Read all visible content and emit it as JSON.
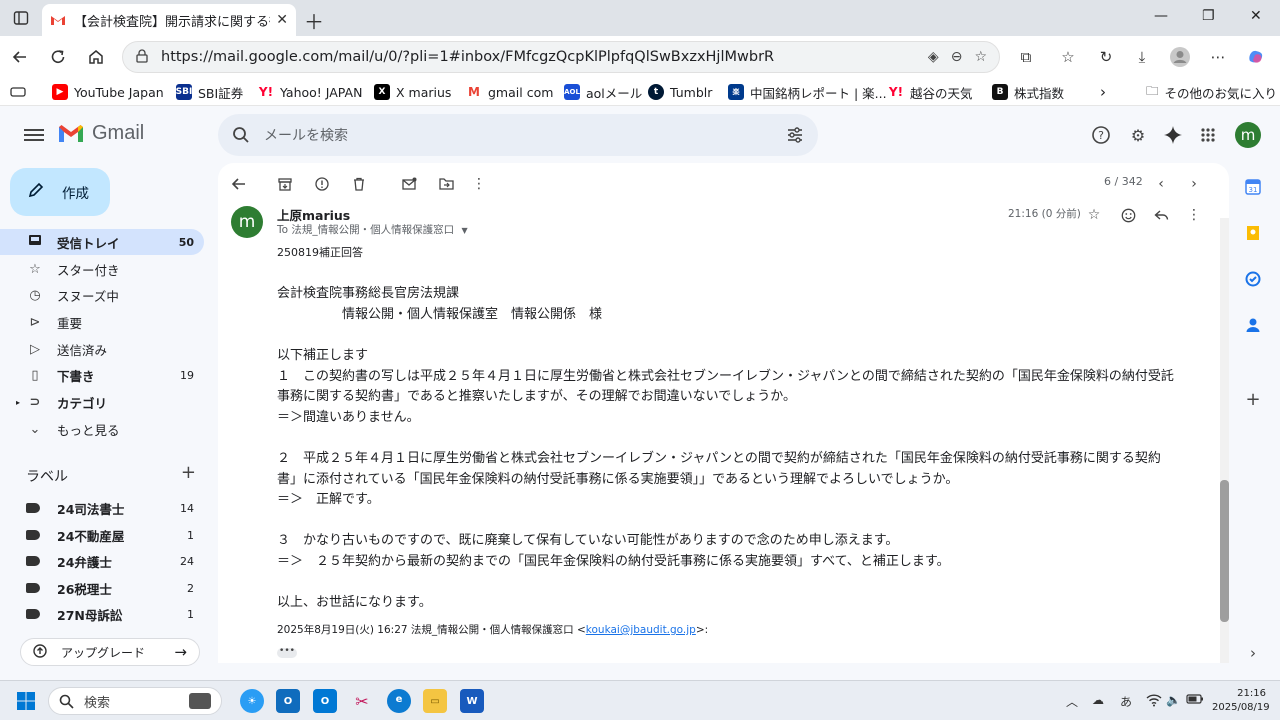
{
  "browser": {
    "tab_title": "【会計検査院】開示請求に関する御",
    "url": "https://mail.google.com/mail/u/0/?pli=1#inbox/FMfcgzQcpKlPlpfqQlSwBxzxHjlMwbrR",
    "bookmarks": [
      "YouTube Japan",
      "SBI証券",
      "Yahoo! JAPAN",
      "X marius",
      "gmail com",
      "aolメール",
      "Tumblr",
      "中国銘柄レポート | 楽...",
      "越谷の天気",
      "株式指数"
    ],
    "other_bookmarks": "その他のお気に入り"
  },
  "gmail": {
    "logo_text": "Gmail",
    "search_placeholder": "メールを検索",
    "avatar_initial": "m",
    "compose_label": "作成",
    "nav": [
      {
        "label": "受信トレイ",
        "count": "50"
      },
      {
        "label": "スター付き",
        "count": ""
      },
      {
        "label": "スヌーズ中",
        "count": ""
      },
      {
        "label": "重要",
        "count": ""
      },
      {
        "label": "送信済み",
        "count": ""
      },
      {
        "label": "下書き",
        "count": "19"
      },
      {
        "label": "カテゴリ",
        "count": ""
      },
      {
        "label": "もっと見る",
        "count": ""
      }
    ],
    "labels_title": "ラベル",
    "labels": [
      {
        "label": "24司法書士",
        "count": "14"
      },
      {
        "label": "24不動産屋",
        "count": "1"
      },
      {
        "label": "24弁護士",
        "count": "24"
      },
      {
        "label": "26税理士",
        "count": "2"
      },
      {
        "label": "27N母訴訟",
        "count": "1"
      }
    ],
    "upgrade_label": "アップグレード",
    "pager": "6 / 342"
  },
  "message": {
    "sender": "上原marius",
    "avatar_initial": "m",
    "to": "To 法規_情報公開・個人情報保護窓口",
    "time": "21:16 (0 分前)",
    "lines": [
      "250819補正回答",
      "",
      "会計検査院事務総長官房法規課",
      "　　　　　情報公開・個人情報保護室　情報公開係　様",
      "",
      "以下補正します",
      "１　この契約書の写しは平成２５年４月１日に厚生労働省と株式会社セブンーイレブン・ジャパンとの間で締結された契約の「国民年金保険料の納付受託",
      "事務に関する契約書」であると推察いたしますが、その理解でお間違いないでしょうか。",
      "＝＞間違いありません。",
      "",
      "２　平成２５年４月１日に厚生労働省と株式会社セブンーイレブン・ジャパンとの間で契約が締結された「国民年金保険料の納付受託事務に関する契約",
      "書」に添付されている「国民年金保険料の納付受託事務に係る実施要領」」であるという理解でよろしいでしょうか。",
      "＝＞　正解です。",
      "",
      "３　かなり古いものですので、既に廃棄して保有していない可能性がありますので念のため申し添えます。",
      "＝＞　２５年契約から最新の契約までの「国民年金保険料の納付受託事務に係る実施要領」すべて、と補正します。",
      "",
      "以上、お世話になります。"
    ],
    "quote_prefix": "2025年8月19日(火) 16:27 法規_情報公開・個人情報保護窓口 <",
    "quote_email": "koukai@jbaudit.go.jp",
    "quote_suffix": ">:",
    "ellipsis": "•••"
  },
  "taskbar": {
    "search_label": "検索",
    "ime": "あ",
    "time": "21:16",
    "date": "2025/08/19"
  }
}
